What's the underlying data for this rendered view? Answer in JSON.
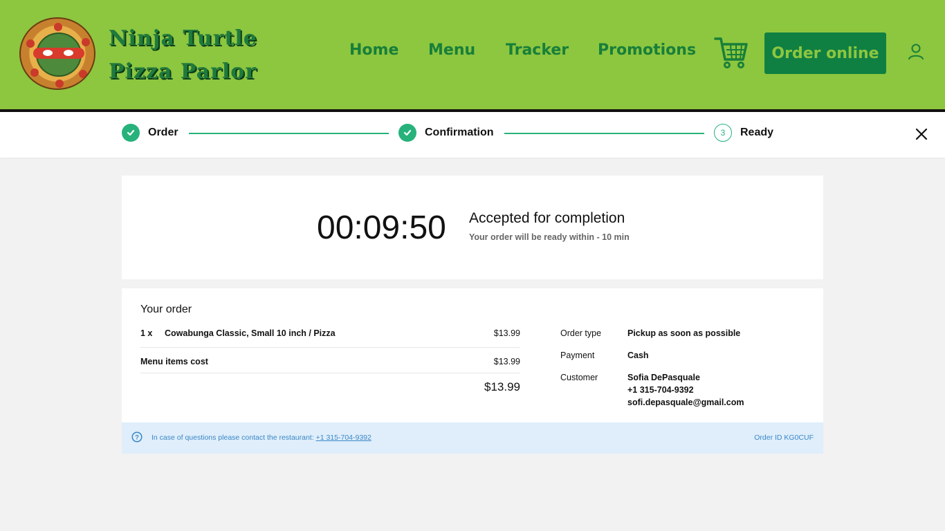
{
  "brand": {
    "line1": "Ninja Turtle",
    "line2": "Pizza Parlor",
    "logo_icon": "turtle-pizza-logo"
  },
  "nav": {
    "items": [
      {
        "label": "Home"
      },
      {
        "label": "Menu"
      },
      {
        "label": "Tracker"
      },
      {
        "label": "Promotions"
      }
    ],
    "cart_icon": "cart-icon",
    "order_button": "Order online",
    "user_icon": "user-icon"
  },
  "colors": {
    "header_bg": "#8dc63f",
    "nav_text": "#187f3a",
    "button_bg": "#0f8042",
    "step_green": "#26b27a",
    "footer_bg": "#dfeefa",
    "footer_text": "#3a86c8"
  },
  "steps": [
    {
      "label": "Order",
      "state": "done"
    },
    {
      "label": "Confirmation",
      "state": "done"
    },
    {
      "label": "Ready",
      "state": "current",
      "number": "3"
    }
  ],
  "timer": {
    "value": "00:09:50",
    "status": "Accepted for completion",
    "subtitle": "Your order will be ready within - 10 min"
  },
  "order": {
    "heading": "Your order",
    "items": [
      {
        "qty": "1 x",
        "name": "Cowabunga Classic, Small 10 inch / Pizza",
        "price": "$13.99"
      }
    ],
    "subtotal_label": "Menu items cost",
    "subtotal_value": "$13.99",
    "total": "$13.99"
  },
  "details": {
    "order_type_label": "Order type",
    "order_type_value": "Pickup as soon as possible",
    "payment_label": "Payment",
    "payment_value": "Cash",
    "customer_label": "Customer",
    "customer_name": "Sofia DePasquale",
    "customer_phone": "+1 315-704-9392",
    "customer_email": "sofi.depasquale@gmail.com"
  },
  "footer": {
    "help_text": "In case of questions please contact the restaurant:",
    "phone": "+1 315-704-9392",
    "order_id": "Order ID KG0CUF"
  }
}
